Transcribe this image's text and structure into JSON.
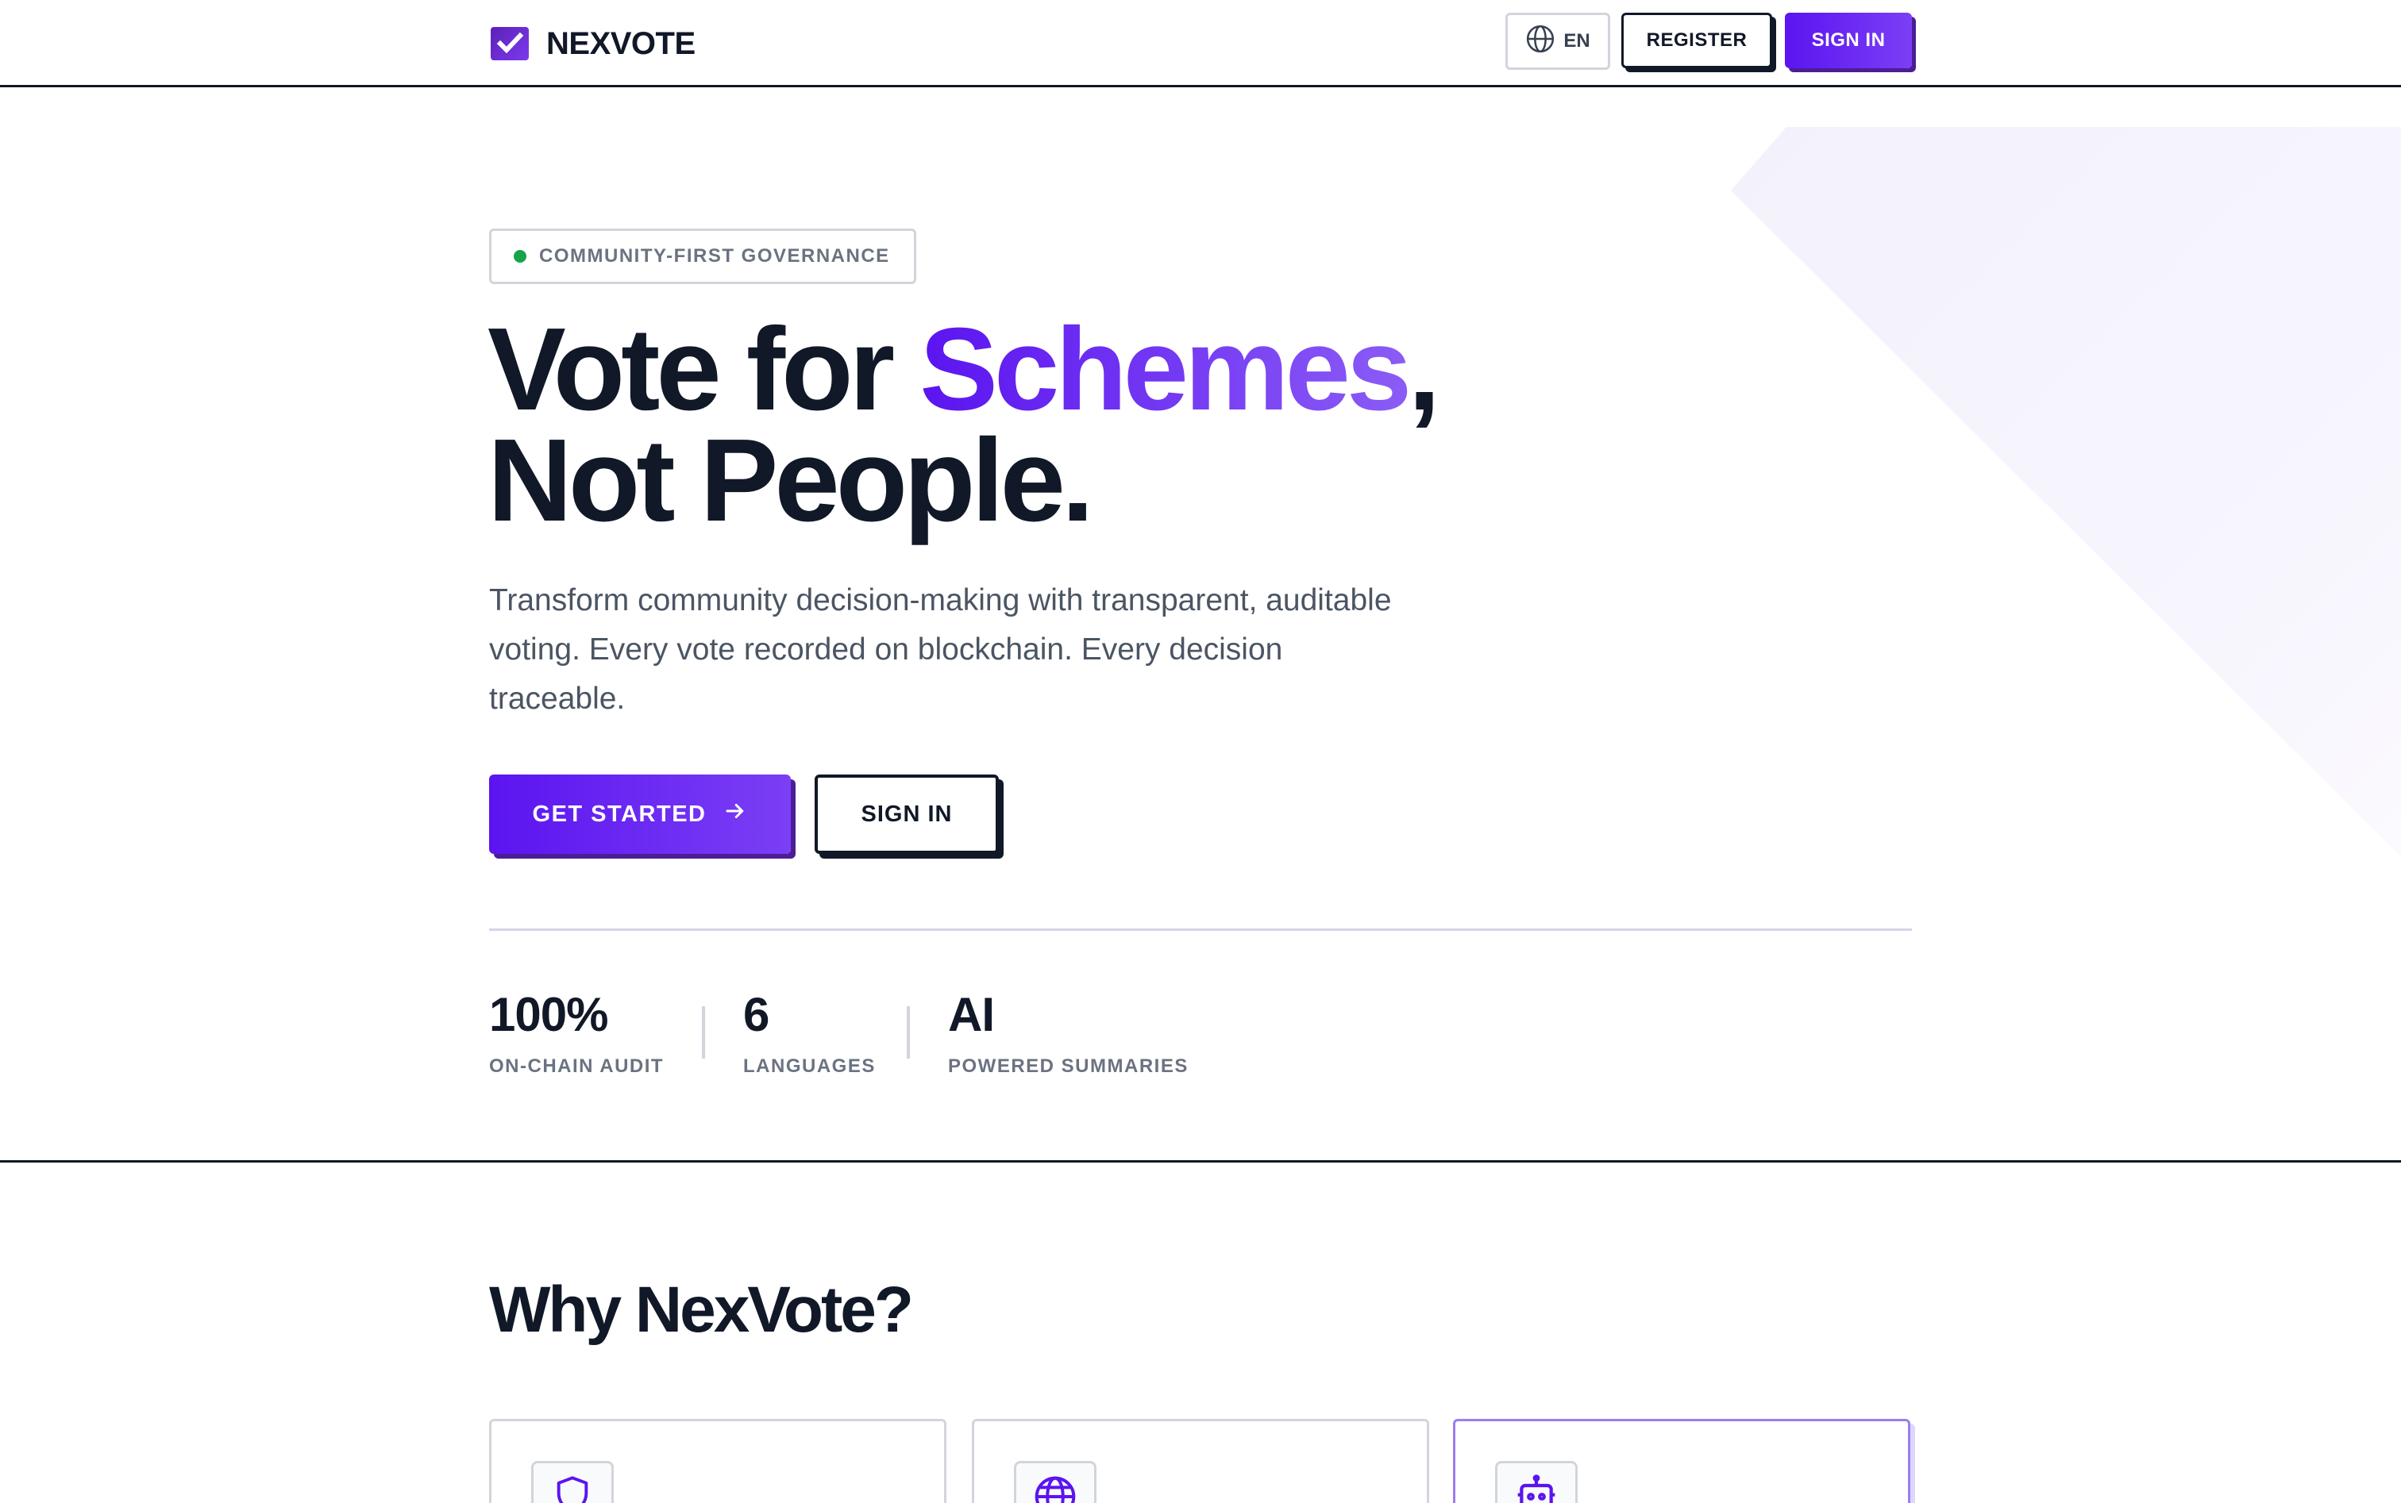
{
  "header": {
    "brand": "NEXVOTE",
    "language": "EN",
    "register_label": "REGISTER",
    "signin_label": "SIGN IN"
  },
  "hero": {
    "badge": "COMMUNITY-FIRST GOVERNANCE",
    "headline_part1": "Vote for ",
    "headline_accent": "Schemes",
    "headline_part2": ",",
    "headline_line2": "Not People.",
    "description": "Transform community decision-making with transparent, auditable voting. Every vote recorded on blockchain. Every decision traceable.",
    "cta_primary": "GET STARTED",
    "cta_secondary": "SIGN IN"
  },
  "stats": [
    {
      "value": "100%",
      "label": "ON-CHAIN AUDIT"
    },
    {
      "value": "6",
      "label": "LANGUAGES"
    },
    {
      "value": "AI",
      "label": "POWERED SUMMARIES"
    }
  ],
  "features": {
    "title": "Why NexVote?",
    "cards": [
      {
        "icon": "shield-icon"
      },
      {
        "icon": "globe-icon"
      },
      {
        "icon": "robot-icon"
      }
    ]
  },
  "colors": {
    "accent": "#5b14f0",
    "accent_light": "#8b5cf6",
    "text": "#111827",
    "muted": "#6b7280",
    "status_dot": "#16a34a"
  }
}
